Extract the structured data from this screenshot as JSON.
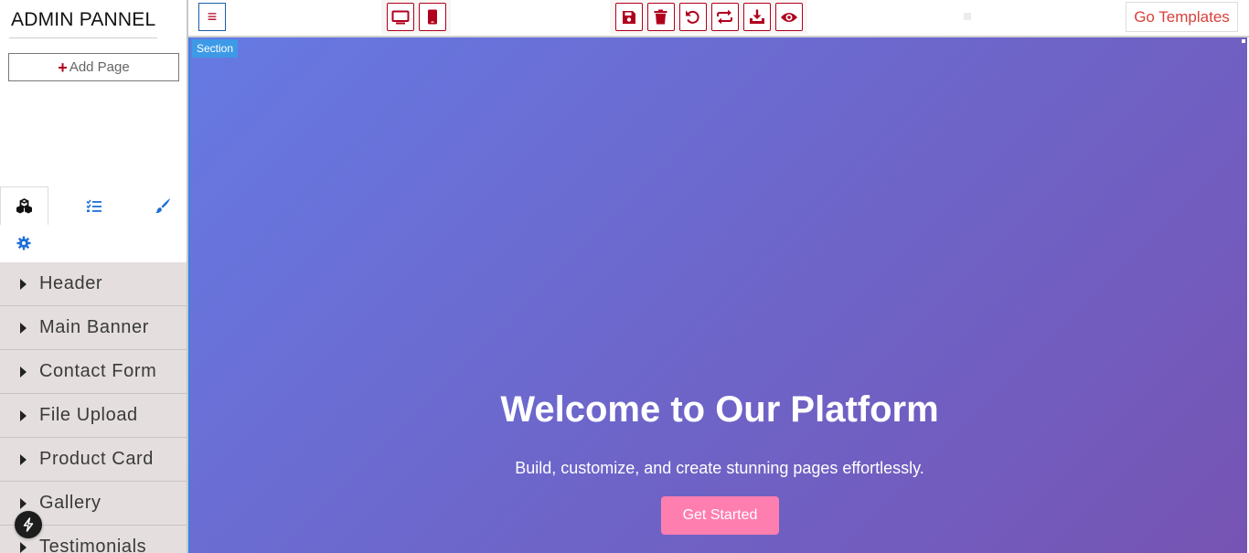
{
  "sidebar": {
    "brand": "ADMIN PANNEL",
    "add_page": {
      "plus": "+",
      "label": "Add Page"
    },
    "tabs": [
      {
        "icon": "blocks-icon",
        "active": true
      },
      {
        "icon": "layer-list-icon",
        "active": false
      },
      {
        "icon": "brush-icon",
        "active": false
      }
    ],
    "settings_icon": "gear-icon",
    "blocks": [
      {
        "label": "Header"
      },
      {
        "label": "Main Banner"
      },
      {
        "label": "Contact Form"
      },
      {
        "label": "File Upload"
      },
      {
        "label": "Product Card"
      },
      {
        "label": "Gallery"
      },
      {
        "label": "Testimonials"
      }
    ]
  },
  "topbar": {
    "menu_icon": "≡",
    "device_buttons": [
      "desktop-icon",
      "mobile-icon"
    ],
    "action_buttons": [
      "save-icon",
      "trash-icon",
      "undo-icon",
      "redo-icon",
      "download-icon",
      "preview-icon"
    ],
    "go_templates": "Go Templates"
  },
  "canvas": {
    "section_badge": "Section",
    "hero": {
      "title": "Welcome to Our Platform",
      "subtitle": "Build, customize, and create stunning pages effortlessly.",
      "cta": "Get Started"
    }
  },
  "colors": {
    "accent_red": "#b0001e",
    "link_red": "#d9403a",
    "hero_gradient_start": "#667ae3",
    "hero_gradient_end": "#7654b3",
    "cta_pink": "#ff7eb0",
    "icon_blue": "#1e6fd9"
  }
}
